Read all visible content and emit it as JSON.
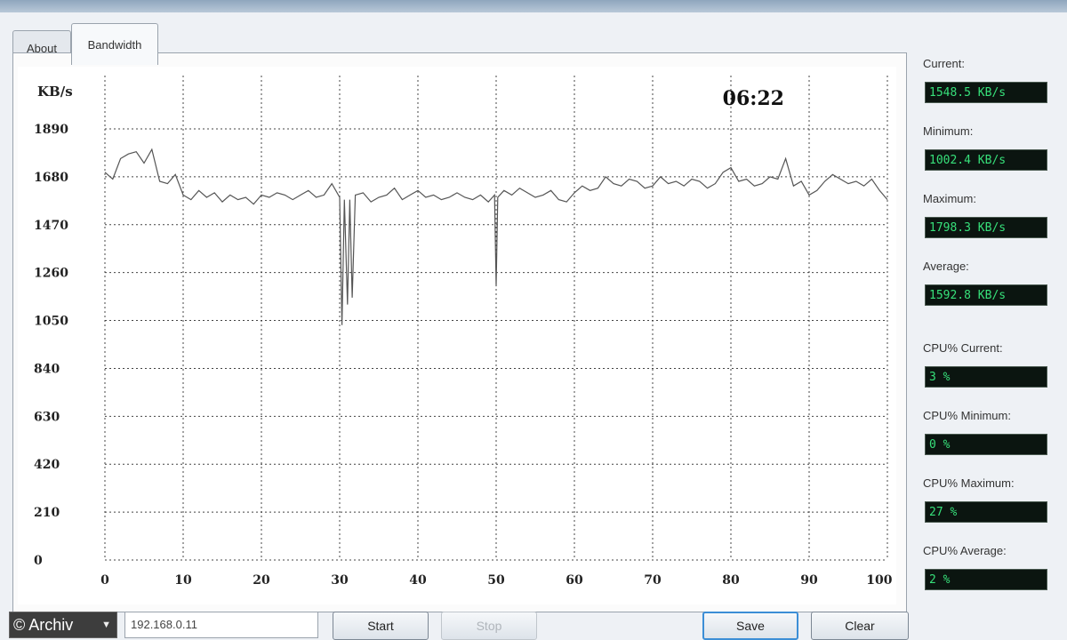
{
  "tabs": [
    {
      "label": "About",
      "active": false
    },
    {
      "label": "Bandwidth",
      "active": true
    }
  ],
  "chart": {
    "unit_label": "KB/s",
    "elapsed": "06:22",
    "y_ticks": [
      "0",
      "210",
      "420",
      "630",
      "840",
      "1050",
      "1260",
      "1470",
      "1680",
      "1890"
    ],
    "x_ticks": [
      "0",
      "10",
      "20",
      "30",
      "40",
      "50",
      "60",
      "70",
      "80",
      "90",
      "100 %"
    ]
  },
  "stats": {
    "current": {
      "label": "Current:",
      "value": "1548.5 KB/s"
    },
    "minimum": {
      "label": "Minimum:",
      "value": "1002.4 KB/s"
    },
    "maximum": {
      "label": "Maximum:",
      "value": "1798.3 KB/s"
    },
    "average": {
      "label": "Average:",
      "value": "1592.8 KB/s"
    },
    "cpu_current": {
      "label": "CPU% Current:",
      "value": "3 %"
    },
    "cpu_minimum": {
      "label": "CPU% Minimum:",
      "value": "0 %"
    },
    "cpu_maximum": {
      "label": "CPU% Maximum:",
      "value": "27 %"
    },
    "cpu_average": {
      "label": "CPU% Average:",
      "value": "2 %"
    }
  },
  "controls": {
    "dropdown_value": "© Archiv",
    "ip_value": "192.168.0.11",
    "start_label": "Start",
    "stop_label": "Stop",
    "save_label": "Save",
    "clear_label": "Clear"
  },
  "colors": {
    "display_bg": "#0b1510",
    "display_text": "#37e07a",
    "trace": "#555555"
  },
  "chart_data": {
    "type": "line",
    "ylabel": "KB/s",
    "ylim": [
      0,
      1890
    ],
    "xlim": [
      0,
      100
    ],
    "grid": true,
    "series": [
      {
        "x": [
          0,
          1,
          2,
          3,
          4,
          5,
          6,
          7,
          8,
          9,
          10,
          11,
          12,
          13,
          14,
          15,
          16,
          17,
          18,
          19,
          20,
          21,
          22,
          23,
          24,
          25,
          26,
          27,
          28,
          29,
          30,
          30.3,
          30.6,
          31,
          31.3,
          31.6,
          32,
          33,
          34,
          35,
          36,
          37,
          38,
          39,
          40,
          41,
          42,
          43,
          44,
          45,
          46,
          47,
          48,
          49,
          49.8,
          50,
          50.2,
          51,
          52,
          53,
          54,
          55,
          56,
          57,
          58,
          59,
          60,
          61,
          62,
          63,
          64,
          65,
          66,
          67,
          68,
          69,
          70,
          71,
          72,
          73,
          74,
          75,
          76,
          77,
          78,
          79,
          80,
          81,
          82,
          83,
          84,
          85,
          86,
          87,
          88,
          89,
          90,
          91,
          92,
          93,
          94,
          95,
          96,
          97,
          98,
          99,
          100
        ],
        "values": [
          1700,
          1670,
          1760,
          1780,
          1790,
          1740,
          1800,
          1660,
          1650,
          1690,
          1600,
          1580,
          1620,
          1590,
          1610,
          1570,
          1600,
          1580,
          1590,
          1560,
          1600,
          1590,
          1610,
          1600,
          1580,
          1600,
          1620,
          1590,
          1600,
          1650,
          1590,
          1030,
          1580,
          1120,
          1580,
          1150,
          1600,
          1610,
          1570,
          1590,
          1600,
          1630,
          1580,
          1600,
          1620,
          1590,
          1600,
          1580,
          1590,
          1610,
          1590,
          1580,
          1600,
          1570,
          1600,
          1200,
          1590,
          1620,
          1600,
          1630,
          1610,
          1590,
          1600,
          1620,
          1580,
          1570,
          1610,
          1640,
          1620,
          1630,
          1680,
          1650,
          1640,
          1670,
          1660,
          1630,
          1640,
          1680,
          1650,
          1660,
          1640,
          1670,
          1660,
          1630,
          1650,
          1700,
          1720,
          1660,
          1670,
          1640,
          1650,
          1680,
          1670,
          1760,
          1640,
          1660,
          1600,
          1620,
          1660,
          1690,
          1670,
          1650,
          1660,
          1640,
          1670,
          1620,
          1580
        ]
      }
    ]
  }
}
